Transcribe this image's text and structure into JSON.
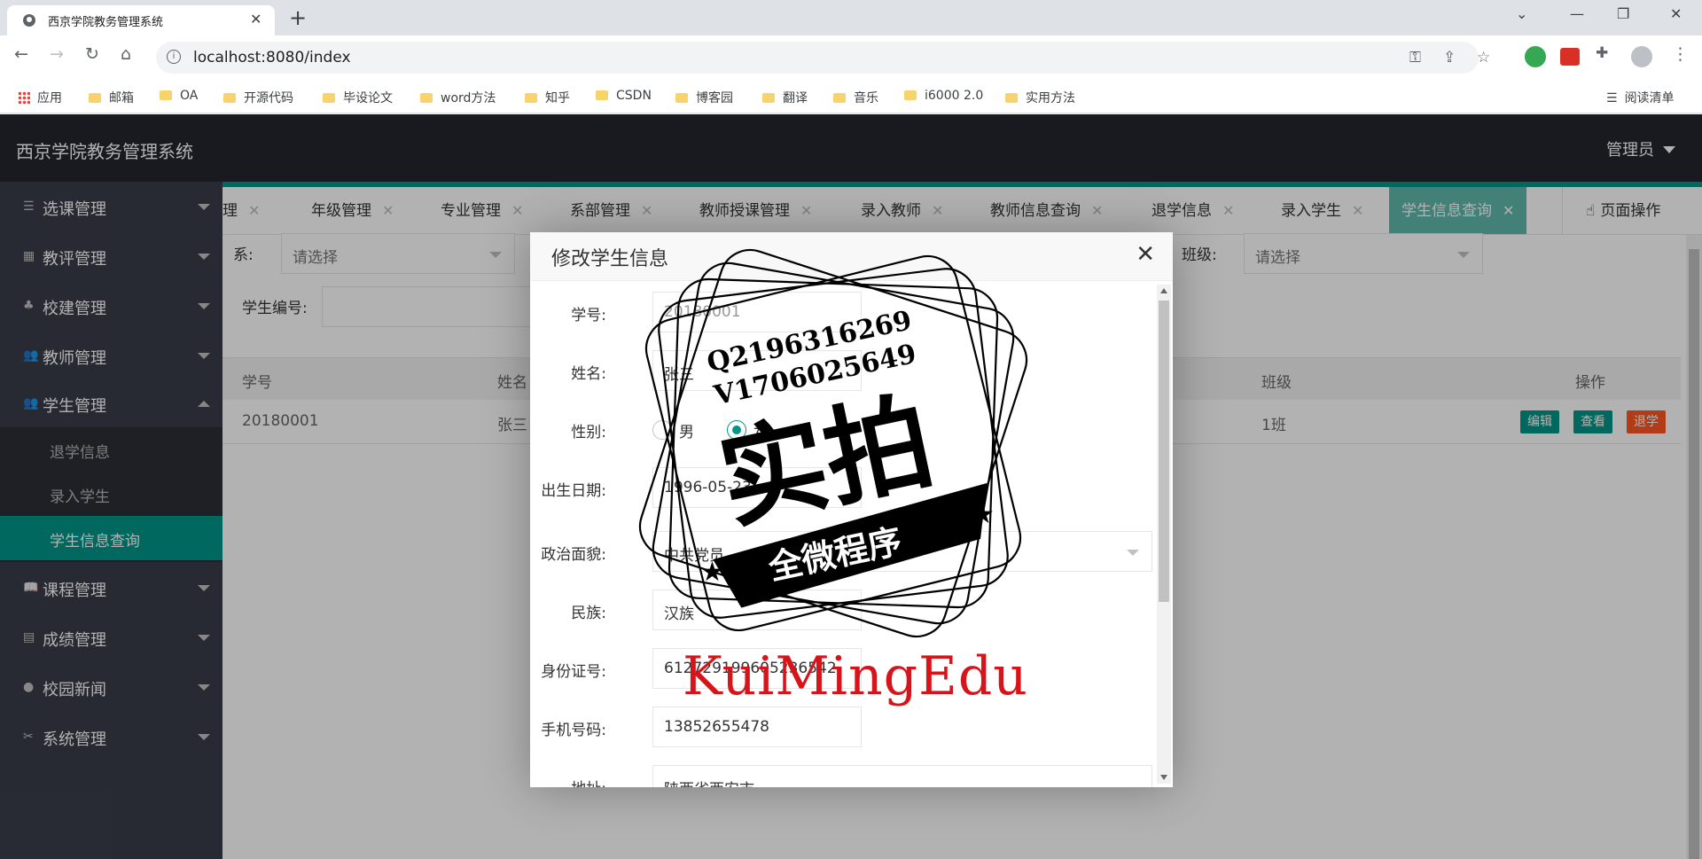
{
  "browser": {
    "tab_title": "西京学院教务管理系统",
    "url": "localhost:8080/index",
    "bookmarks": [
      "应用",
      "邮箱",
      "OA",
      "开源代码",
      "毕设论文",
      "word方法",
      "知乎",
      "CSDN",
      "博客园",
      "翻译",
      "音乐",
      "i6000 2.0",
      "实用方法"
    ],
    "reading_list": "阅读清单"
  },
  "app": {
    "title": "西京学院教务管理系统",
    "user": "管理员"
  },
  "sidebar": {
    "items": [
      {
        "label": "选课管理",
        "icon": "list-icon"
      },
      {
        "label": "教评管理",
        "icon": "grid-icon"
      },
      {
        "label": "校建管理",
        "icon": "tree-icon"
      },
      {
        "label": "教师管理",
        "icon": "users-icon"
      },
      {
        "label": "学生管理",
        "icon": "users-icon"
      },
      {
        "label": "课程管理",
        "icon": "book-icon"
      },
      {
        "label": "成绩管理",
        "icon": "clipboard-icon"
      },
      {
        "label": "校园新闻",
        "icon": "chat-icon"
      },
      {
        "label": "系统管理",
        "icon": "tools-icon"
      }
    ],
    "student_sub": [
      "退学信息",
      "录入学生",
      "学生信息查询"
    ]
  },
  "page_tabs": [
    "理",
    "年级管理",
    "专业管理",
    "系部管理",
    "教师授课管理",
    "录入教师",
    "教师信息查询",
    "退学信息",
    "录入学生",
    "学生信息查询"
  ],
  "page_ops": "页面操作",
  "filters": {
    "dept_label": "系:",
    "dept_placeholder": "请选择",
    "class_label": "班级:",
    "class_placeholder": "请选择",
    "student_no_label": "学生编号:"
  },
  "table": {
    "headers": [
      "学号",
      "姓名",
      "班级",
      "操作"
    ],
    "row": {
      "id": "20180001",
      "name": "张三",
      "class": "1班"
    },
    "actions": {
      "edit": "编辑",
      "view": "查看",
      "withdraw": "退学"
    }
  },
  "dialog": {
    "title": "修改学生信息",
    "fields": {
      "student_no_label": "学号:",
      "student_no": "20180001",
      "name_label": "姓名:",
      "name": "张三",
      "gender_label": "性别:",
      "gender_male": "男",
      "gender_female": "女",
      "birth_label": "出生日期:",
      "birth": "1996-05-23",
      "politics_label": "政治面貌:",
      "politics": "中共党员",
      "ethnic_label": "民族:",
      "ethnic": "汉族",
      "id_label": "身份证号:",
      "id_no": "612729199605236542",
      "phone_label": "手机号码:",
      "phone": "13852655478",
      "address_label": "地址:",
      "address": "陕西省西安市"
    }
  },
  "watermark": {
    "q": "Q2196316269",
    "v": "V1706025649",
    "big": "实拍",
    "banner": "全微程序",
    "brand": "KuiMingEdu"
  },
  "colors": {
    "accent": "#009688",
    "header": "#23262e",
    "sidebar": "#393d49",
    "danger": "#ff5722",
    "watermark_red": "#d7141a"
  }
}
